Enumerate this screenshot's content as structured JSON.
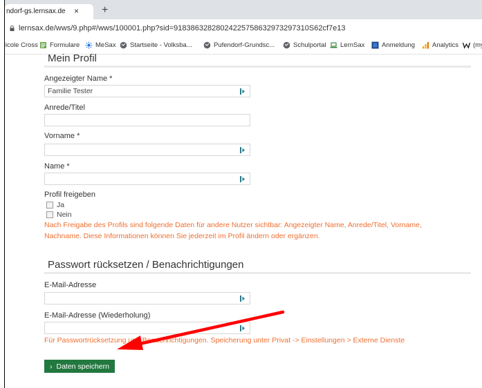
{
  "browser": {
    "tab_title": "ndorf-gs.lernsax.de",
    "tab_close": "×",
    "new_tab": "+",
    "url": "lernsax.de/wws/9.php#/wws/100001.php?sid=91838632828024225758632973297310S62cf7e13"
  },
  "bookmarks": [
    {
      "label": "Nicole Cross",
      "icon": "none"
    },
    {
      "label": "Formulare",
      "icon": "forms-icon"
    },
    {
      "label": "MeSax",
      "icon": "mesax-icon"
    },
    {
      "label": "Startseite - Volksba...",
      "icon": "globe-icon"
    },
    {
      "label": "Pufendorf-Grundsc...",
      "icon": "globe-icon"
    },
    {
      "label": "Schulportal",
      "icon": "globe-icon"
    },
    {
      "label": "LernSax",
      "icon": "laptop-icon"
    },
    {
      "label": "Anmeldung",
      "icon": "anmeldung-icon"
    },
    {
      "label": "Analytics",
      "icon": "analytics-icon"
    },
    {
      "label": "(my",
      "icon": "w-icon"
    }
  ],
  "profile": {
    "title": "Mein Profil",
    "display_name_label": "Angezeigter Name *",
    "display_name_value": "Familie Tester",
    "salutation_label": "Anrede/Titel",
    "firstname_label": "Vorname *",
    "name_label": "Name *",
    "share_label": "Profil freigeben",
    "option_yes": "Ja",
    "option_no": "Nein",
    "share_note": "Nach Freigabe des Profils sind folgende Daten für andere Nutzer sichtbar: Angezeigter Name, Anrede/Titel, Vorname, Nachname. Diese Informationen können Sie jederzeit im Profil ändern oder ergänzen."
  },
  "password": {
    "title": "Passwort rücksetzen / Benachrichtigungen",
    "email_label": "E-Mail-Adresse",
    "email_repeat_label": "E-Mail-Adresse (Wiederholung)",
    "note": "Für Passwortrücksetzung und Benachrichtigungen. Speicherung unter Privat -> Einstellungen > Externe Dienste"
  },
  "save_button": {
    "icon": "›",
    "label": "Daten speichern"
  },
  "colors": {
    "accent": "#ee6f31",
    "button": "#23783f",
    "annotation_arrow": "#ff0000"
  }
}
